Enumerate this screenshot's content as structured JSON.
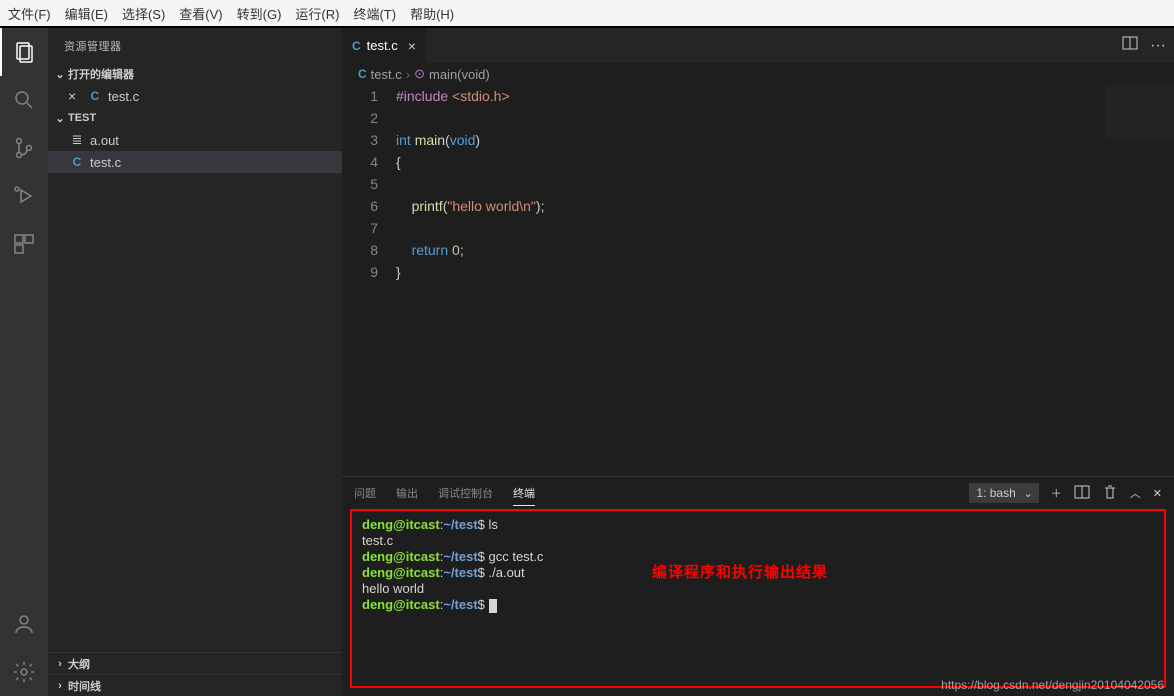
{
  "menubar": [
    "文件(F)",
    "编辑(E)",
    "选择(S)",
    "查看(V)",
    "转到(G)",
    "运行(R)",
    "终端(T)",
    "帮助(H)"
  ],
  "sidebar": {
    "title": "资源管理器",
    "openEditors": {
      "label": "打开的编辑器",
      "items": [
        {
          "name": "test.c",
          "icon": "C"
        }
      ]
    },
    "folder": {
      "name": "TEST",
      "items": [
        {
          "name": "a.out",
          "icon": "≣"
        },
        {
          "name": "test.c",
          "icon": "C",
          "selected": true
        }
      ]
    },
    "outline": "大纲",
    "timeline": "时间线"
  },
  "tabs": [
    {
      "name": "test.c",
      "icon": "C"
    }
  ],
  "breadcrumb": {
    "file": "test.c",
    "fileIcon": "C",
    "symbol": "main(void)",
    "symbolIcon": "⊙"
  },
  "code": {
    "lines": [
      {
        "n": 1,
        "html": "<span class='pp'>#include</span> <span class='str'>&lt;stdio.h&gt;</span>"
      },
      {
        "n": 2,
        "html": ""
      },
      {
        "n": 3,
        "html": "<span class='kw'>int</span> <span class='fn'>main</span>(<span class='kw'>void</span>)"
      },
      {
        "n": 4,
        "html": "{"
      },
      {
        "n": 5,
        "html": ""
      },
      {
        "n": 6,
        "html": "    <span class='fn'>printf</span>(<span class='str'>\"hello world\\n\"</span>);"
      },
      {
        "n": 7,
        "html": ""
      },
      {
        "n": 8,
        "html": "    <span class='kw'>return</span> <span class='num'>0</span>;"
      },
      {
        "n": 9,
        "html": "}"
      }
    ]
  },
  "panel": {
    "tabs": [
      "问题",
      "输出",
      "调试控制台",
      "终端"
    ],
    "activeTab": 3,
    "terminalSelect": "1: bash",
    "annotation": "编译程序和执行输出结果",
    "lines": [
      {
        "segs": [
          {
            "c": "green",
            "t": "deng@itcast"
          },
          {
            "c": "white",
            "t": ":"
          },
          {
            "c": "blue",
            "t": "~/test"
          },
          {
            "c": "white",
            "t": "$ ls"
          }
        ]
      },
      {
        "segs": [
          {
            "c": "white",
            "t": "test.c"
          }
        ]
      },
      {
        "segs": [
          {
            "c": "green",
            "t": "deng@itcast"
          },
          {
            "c": "white",
            "t": ":"
          },
          {
            "c": "blue",
            "t": "~/test"
          },
          {
            "c": "white",
            "t": "$ gcc test.c"
          }
        ]
      },
      {
        "segs": [
          {
            "c": "green",
            "t": "deng@itcast"
          },
          {
            "c": "white",
            "t": ":"
          },
          {
            "c": "blue",
            "t": "~/test"
          },
          {
            "c": "white",
            "t": "$ ./a.out"
          }
        ]
      },
      {
        "segs": [
          {
            "c": "white",
            "t": "hello world"
          }
        ]
      },
      {
        "segs": [
          {
            "c": "green",
            "t": "deng@itcast"
          },
          {
            "c": "white",
            "t": ":"
          },
          {
            "c": "blue",
            "t": "~/test"
          },
          {
            "c": "white",
            "t": "$ "
          }
        ],
        "cursor": true
      }
    ]
  },
  "watermark": "https://blog.csdn.net/dengjin20104042056"
}
